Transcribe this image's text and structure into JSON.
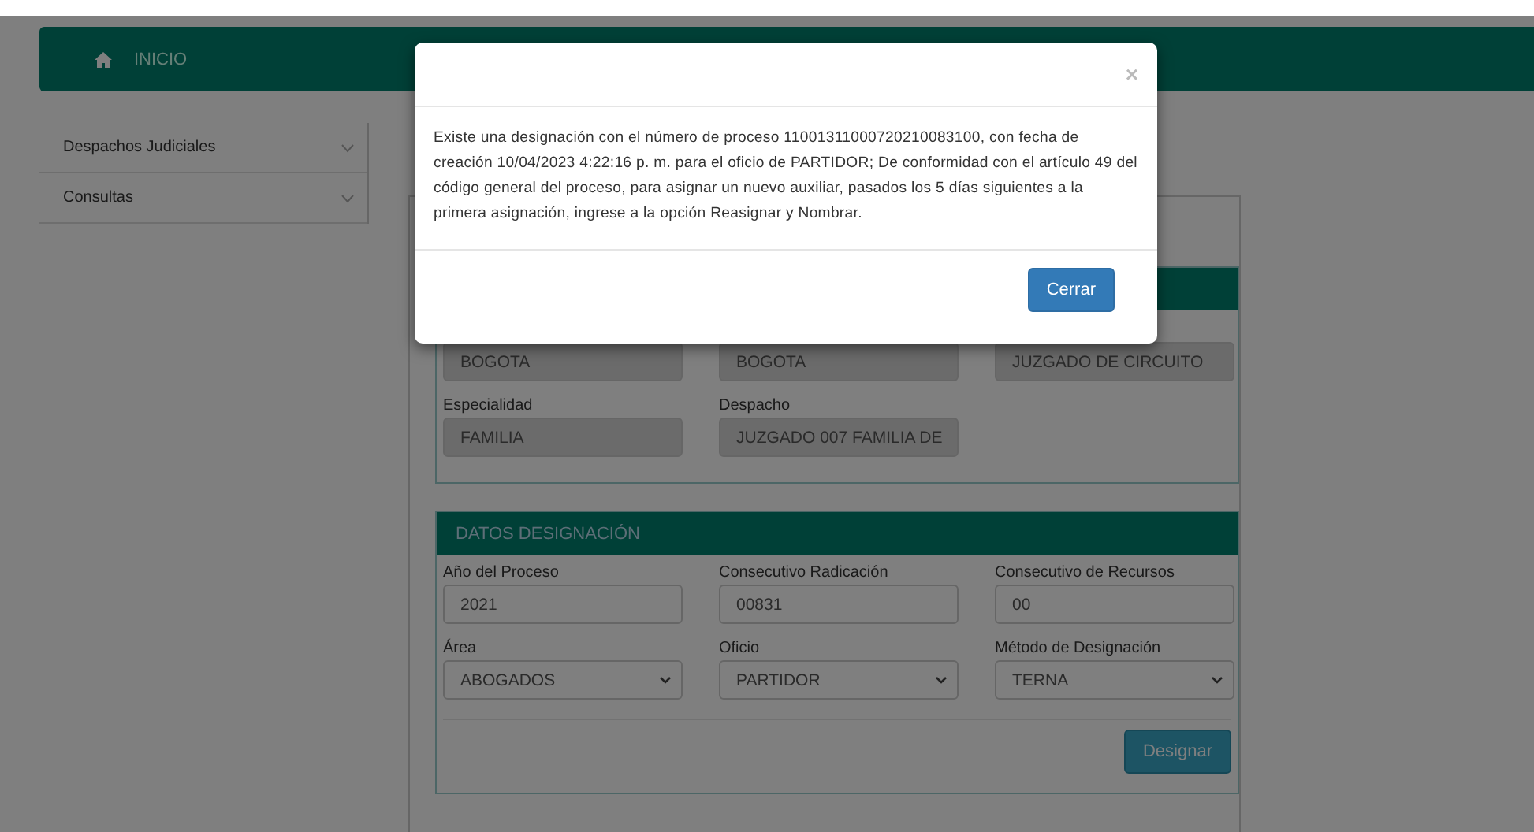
{
  "navbar": {
    "home_label": "INICIO"
  },
  "sidebar": {
    "items": [
      {
        "label": "Despachos Judiciales",
        "expanded": false
      },
      {
        "label": "Consultas",
        "expanded": false
      }
    ]
  },
  "sections": [
    {
      "fields": [
        {
          "kind": "text",
          "value": "BOGOTA",
          "disabled": true
        },
        {
          "kind": "text",
          "value": "BOGOTA",
          "disabled": true
        },
        {
          "kind": "text",
          "value": "JUZGADO DE CIRCUITO",
          "disabled": true
        },
        {
          "kind": "text",
          "label": "Especialidad",
          "value": "FAMILIA",
          "disabled": true
        },
        {
          "kind": "text",
          "label": "Despacho",
          "value": "JUZGADO 007  FAMILIA DE",
          "disabled": true
        }
      ]
    },
    {
      "title": "DATOS DESIGNACIÓN",
      "fields": [
        {
          "kind": "text",
          "label": "Año del Proceso",
          "value": "2021",
          "disabled": false
        },
        {
          "kind": "text",
          "label": "Consecutivo Radicación",
          "value": "00831",
          "disabled": false
        },
        {
          "kind": "text",
          "label": "Consecutivo de Recursos",
          "value": "00",
          "disabled": false
        },
        {
          "kind": "select",
          "label": "Área",
          "value": "ABOGADOS",
          "disabled": false
        },
        {
          "kind": "select",
          "label": "Oficio",
          "value": "PARTIDOR",
          "disabled": false
        },
        {
          "kind": "select",
          "label": "Método de Designación",
          "value": "TERNA",
          "disabled": false
        }
      ],
      "button": "Designar"
    }
  ],
  "modal": {
    "close_symbol": "×",
    "message": "Existe una designación con el número de proceso 11001311000720210083100, con fecha de creación 10/04/2023 4:22:16 p. m. para el oficio de PARTIDOR; De conformidad con el artículo 49 del código general del proceso, para asignar un nuevo auxiliar, pasados los 5 días siguientes a la primera asignación, ingrese a la opción Reasignar y Nombrar.",
    "button": "Cerrar"
  }
}
